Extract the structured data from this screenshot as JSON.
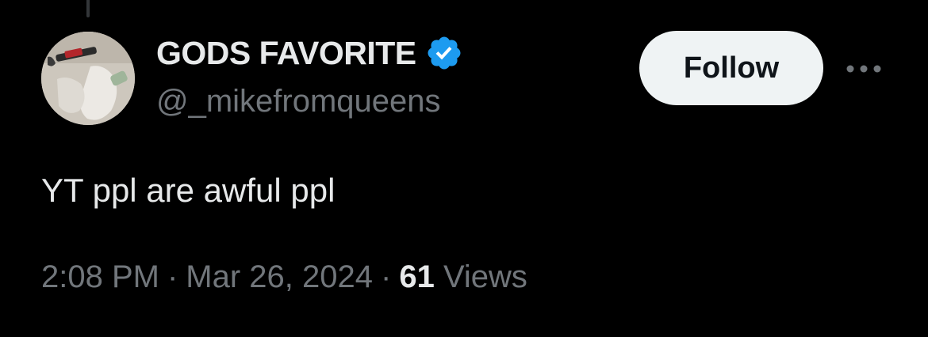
{
  "tweet": {
    "author": {
      "display_name": "GODS FAVORITE",
      "handle": "@_mikefromqueens",
      "verified_icon": "verified-badge-icon",
      "avatar": "avatar-photo"
    },
    "follow_label": "Follow",
    "more_icon": "more-options-icon",
    "text": "YT ppl are awful ppl",
    "time": "2:08 PM",
    "separator": "·",
    "date": "Mar 26, 2024",
    "views_count": "61",
    "views_label": "Views"
  },
  "colors": {
    "background": "#000000",
    "primary_text": "#e7e9ea",
    "secondary_text": "#71767b",
    "verified_blue": "#1d9bf0",
    "follow_bg": "#eff3f4",
    "follow_text": "#0f1419"
  }
}
